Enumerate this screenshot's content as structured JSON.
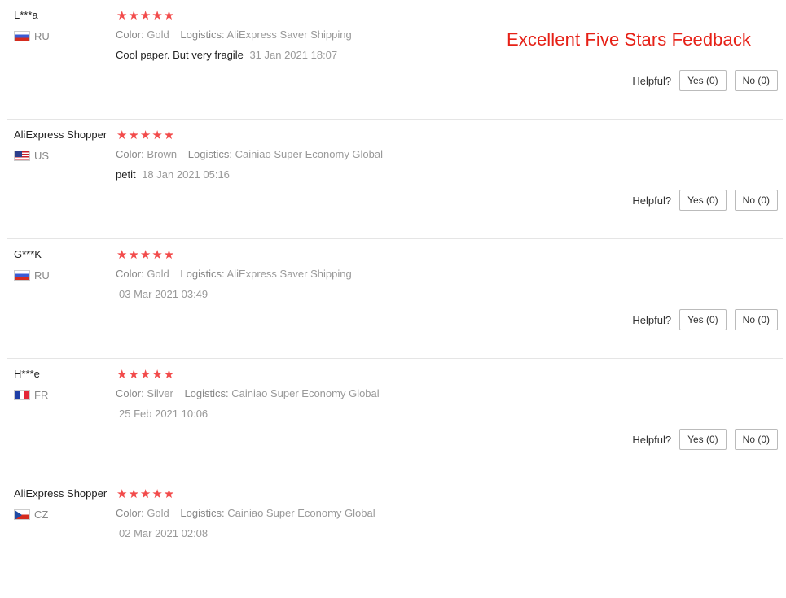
{
  "banner": "Excellent Five Stars Feedback",
  "labels": {
    "color": "Color:",
    "logistics": "Logistics:",
    "helpful": "Helpful?"
  },
  "accent_color": "#e62117",
  "star_color": "#f24b4b",
  "reviews": [
    {
      "user": "L***a",
      "flag": "flag-ru",
      "country": "RU",
      "rating": 5,
      "stars": "★★★★★",
      "color": "Gold",
      "logistics": "AliExpress Saver Shipping",
      "text": "Cool paper. But very fragile",
      "time": "31 Jan 2021 18:07",
      "yes": "Yes (0)",
      "no": "No (0)"
    },
    {
      "user": "AliExpress Shopper",
      "flag": "flag-us",
      "country": "US",
      "rating": 5,
      "stars": "★★★★★",
      "color": "Brown",
      "logistics": "Cainiao Super Economy Global",
      "text": "petit",
      "time": "18 Jan 2021 05:16",
      "yes": "Yes (0)",
      "no": "No (0)"
    },
    {
      "user": "G***K",
      "flag": "flag-ru",
      "country": "RU",
      "rating": 5,
      "stars": "★★★★★",
      "color": "Gold",
      "logistics": "AliExpress Saver Shipping",
      "text": "",
      "time": "03 Mar 2021 03:49",
      "yes": "Yes (0)",
      "no": "No (0)"
    },
    {
      "user": "H***e",
      "flag": "flag-fr",
      "country": "FR",
      "rating": 5,
      "stars": "★★★★★",
      "color": "Silver",
      "logistics": "Cainiao Super Economy Global",
      "text": "",
      "time": "25 Feb 2021 10:06",
      "yes": "Yes (0)",
      "no": "No (0)"
    },
    {
      "user": "AliExpress Shopper",
      "flag": "flag-cz",
      "country": "CZ",
      "rating": 5,
      "stars": "★★★★★",
      "color": "Gold",
      "logistics": "Cainiao Super Economy Global",
      "text": "",
      "time": "02 Mar 2021 02:08",
      "yes": "Yes (0)",
      "no": "No (0)"
    }
  ]
}
